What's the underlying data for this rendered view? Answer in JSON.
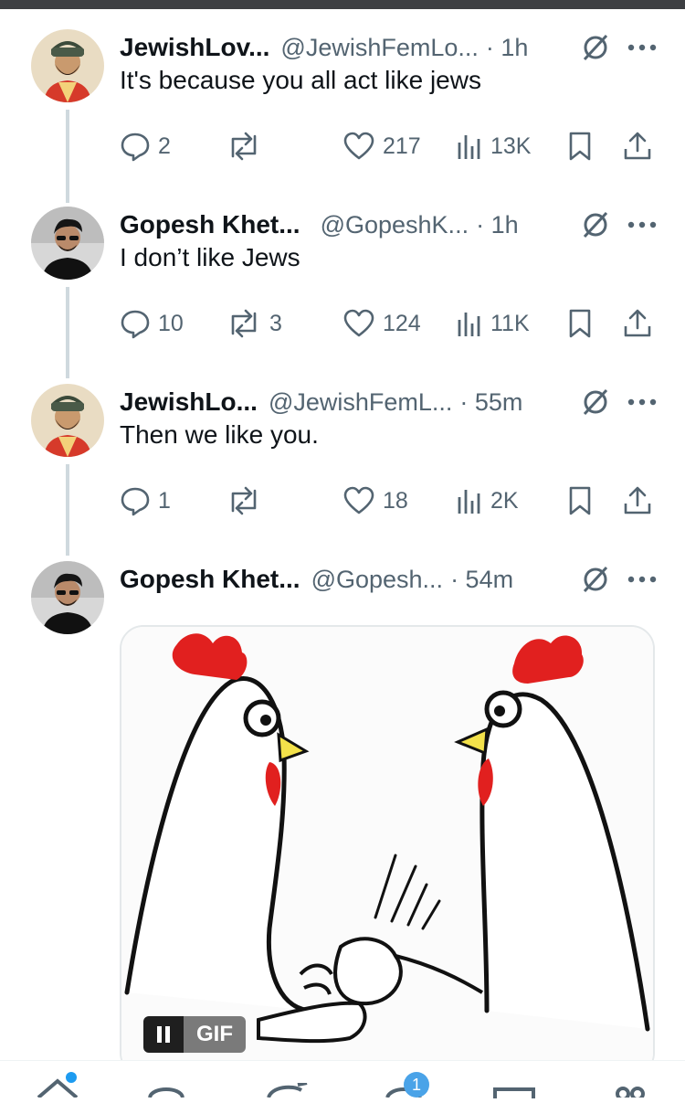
{
  "tweets": [
    {
      "name": "JewishLov...",
      "handle": "@JewishFemLo...",
      "time": "· 1h",
      "text": "It's because you all act like jews",
      "replies": "2",
      "retweets": "",
      "likes": "217",
      "views": "13K"
    },
    {
      "name": "Gopesh Khet...",
      "handle": "@GopeshK...",
      "time": "· 1h",
      "text": "I don’t like Jews",
      "replies": "10",
      "retweets": "3",
      "likes": "124",
      "views": "11K"
    },
    {
      "name": "JewishLo...",
      "handle": "@JewishFemL...",
      "time": "· 55m",
      "text": "Then we like you.",
      "replies": "1",
      "retweets": "",
      "likes": "18",
      "views": "2K"
    },
    {
      "name": "Gopesh Khet...",
      "handle": "@Gopesh...",
      "time": "· 54m",
      "media": {
        "type": "gif",
        "badge_label": "GIF"
      }
    }
  ],
  "bottom_nav": {
    "notifications_badge": "1",
    "icons": [
      "home-icon",
      "search-icon",
      "grok-icon",
      "notifications-icon",
      "messages-icon",
      "communities-icon"
    ]
  },
  "colors": {
    "text": "#0f1419",
    "secondary": "#536471",
    "thread_line": "#cfd9de",
    "accent": "#1d9bf0"
  }
}
